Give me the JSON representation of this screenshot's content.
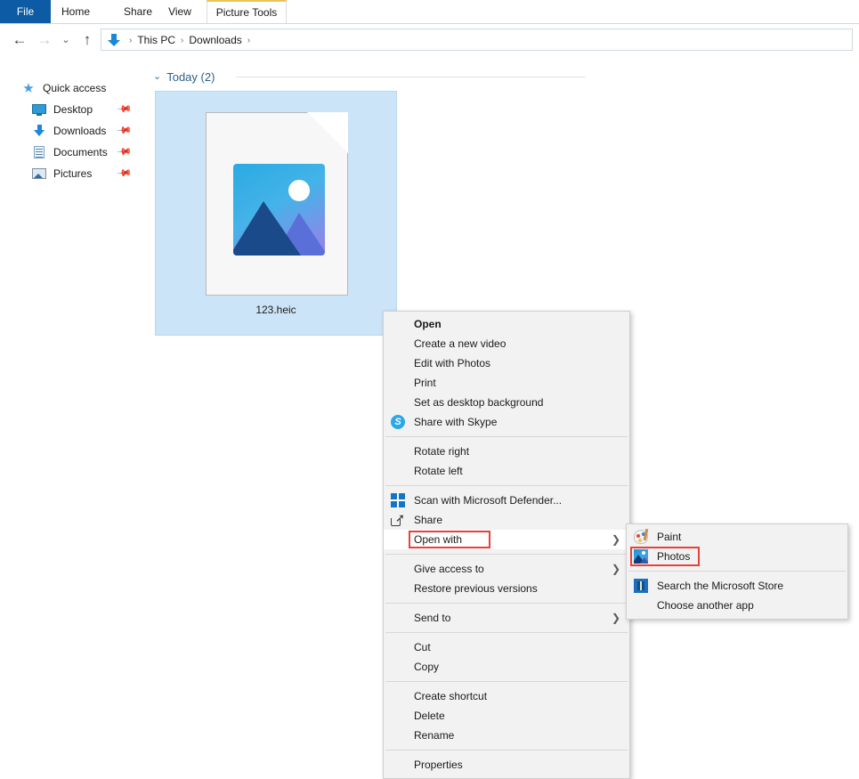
{
  "window": {
    "tabs": [
      {
        "label": "File",
        "name": "tab-file"
      },
      {
        "label": "Home",
        "name": "tab-home"
      },
      {
        "label": "Share",
        "name": "tab-share"
      },
      {
        "label": "View",
        "name": "tab-view"
      },
      {
        "label": "Picture Tools",
        "name": "tab-picture-tools"
      }
    ],
    "accent_color": "#0c5ba4",
    "picture_tools_accent": "#e8c55a"
  },
  "navbar": {
    "back_icon": "←",
    "forward_icon": "→",
    "recent_icon": "⌄",
    "up_icon": "↑",
    "breadcrumbs": [
      {
        "label": "This PC"
      },
      {
        "label": "Downloads"
      }
    ],
    "separator": "›",
    "location_icon": "downloads-icon"
  },
  "sidebar": {
    "items": [
      {
        "label": "Quick access",
        "icon": "star-pin-icon",
        "pinned": false,
        "child": false
      },
      {
        "label": "Desktop",
        "icon": "desktop-icon",
        "pinned": true,
        "child": true
      },
      {
        "label": "Downloads",
        "icon": "downloads-icon",
        "pinned": true,
        "child": true
      },
      {
        "label": "Documents",
        "icon": "documents-icon",
        "pinned": true,
        "child": true
      },
      {
        "label": "Pictures",
        "icon": "pictures-icon",
        "pinned": true,
        "child": true
      }
    ],
    "pin_glyph": "📌"
  },
  "content": {
    "group": {
      "chevron": "⌄",
      "label": "Today (2)"
    },
    "file": {
      "name": "123.heic",
      "selected": true,
      "thumbnail": "image-file-thumbnail"
    }
  },
  "context_menu": {
    "items": [
      {
        "label": "Open",
        "bold": true,
        "icon": null,
        "arrow": false,
        "sep_after": false
      },
      {
        "label": "Create a new video",
        "bold": false,
        "icon": null,
        "arrow": false,
        "sep_after": false
      },
      {
        "label": "Edit with Photos",
        "bold": false,
        "icon": null,
        "arrow": false,
        "sep_after": false
      },
      {
        "label": "Print",
        "bold": false,
        "icon": null,
        "arrow": false,
        "sep_after": false
      },
      {
        "label": "Set as desktop background",
        "bold": false,
        "icon": null,
        "arrow": false,
        "sep_after": false
      },
      {
        "label": "Share with Skype",
        "bold": false,
        "icon": "skype-icon",
        "arrow": false,
        "sep_after": true
      },
      {
        "label": "Rotate right",
        "bold": false,
        "icon": null,
        "arrow": false,
        "sep_after": false
      },
      {
        "label": "Rotate left",
        "bold": false,
        "icon": null,
        "arrow": false,
        "sep_after": true
      },
      {
        "label": "Scan with Microsoft Defender...",
        "bold": false,
        "icon": "defender-icon",
        "arrow": false,
        "sep_after": false
      },
      {
        "label": "Share",
        "bold": false,
        "icon": "share-icon",
        "arrow": false,
        "sep_after": false
      },
      {
        "label": "Open with",
        "bold": false,
        "icon": null,
        "arrow": true,
        "sep_after": true,
        "highlighted": true,
        "outlined": true
      },
      {
        "label": "Give access to",
        "bold": false,
        "icon": null,
        "arrow": true,
        "sep_after": false
      },
      {
        "label": "Restore previous versions",
        "bold": false,
        "icon": null,
        "arrow": false,
        "sep_after": true
      },
      {
        "label": "Send to",
        "bold": false,
        "icon": null,
        "arrow": true,
        "sep_after": true
      },
      {
        "label": "Cut",
        "bold": false,
        "icon": null,
        "arrow": false,
        "sep_after": false
      },
      {
        "label": "Copy",
        "bold": false,
        "icon": null,
        "arrow": false,
        "sep_after": true
      },
      {
        "label": "Create shortcut",
        "bold": false,
        "icon": null,
        "arrow": false,
        "sep_after": false
      },
      {
        "label": "Delete",
        "bold": false,
        "icon": null,
        "arrow": false,
        "sep_after": false
      },
      {
        "label": "Rename",
        "bold": false,
        "icon": null,
        "arrow": false,
        "sep_after": true
      },
      {
        "label": "Properties",
        "bold": false,
        "icon": null,
        "arrow": false,
        "sep_after": false
      }
    ],
    "arrow_glyph": "❯",
    "highlight_outline_color": "#e8403a"
  },
  "open_with_submenu": {
    "items": [
      {
        "label": "Paint",
        "icon": "paint-icon",
        "sep_after": false
      },
      {
        "label": "Photos",
        "icon": "photos-icon",
        "sep_after": true,
        "outlined": true
      },
      {
        "label": "Search the Microsoft Store",
        "icon": "store-icon",
        "sep_after": false
      },
      {
        "label": "Choose another app",
        "icon": null,
        "sep_after": false
      }
    ]
  }
}
